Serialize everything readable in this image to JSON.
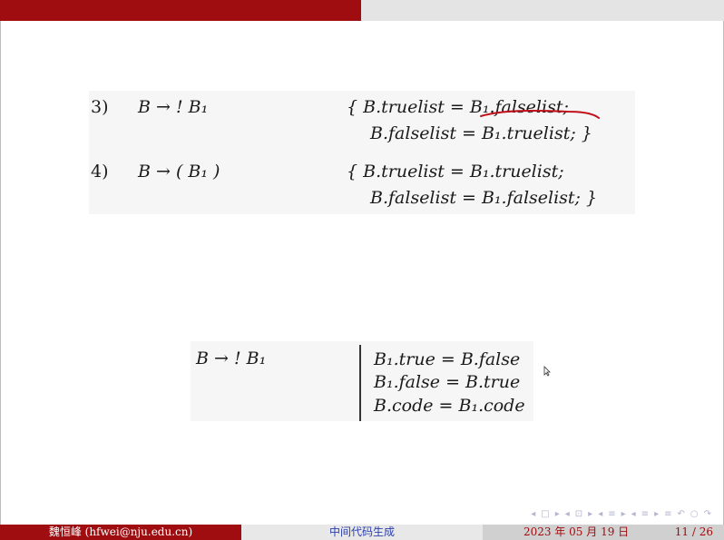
{
  "slide": {
    "rule3": {
      "label": "3)",
      "production": "B → ! B₁",
      "action_line1": "{  B.truelist = B₁.falselist;",
      "action_line2": "B.falselist = B₁.truelist;  }"
    },
    "rule4": {
      "label": "4)",
      "production": "B → ( B₁ )",
      "action_line1": "{  B.truelist = B₁.truelist;",
      "action_line2": "B.falselist  =  B₁.falselist;  }"
    },
    "lower": {
      "production": "B  →  ! B₁",
      "rule_line1": "B₁.true = B.false",
      "rule_line2": "B₁.false = B.true",
      "rule_line3": "B.code = B₁.code"
    },
    "annotation_color": "#c0101a"
  },
  "nav": {
    "icons": [
      "◂",
      "□",
      "▸",
      "◂",
      "⊡",
      "▸",
      "◂",
      "≡",
      "▸",
      "◂",
      "≡",
      "▸",
      "≡",
      "↶",
      "○",
      "↷"
    ]
  },
  "footer": {
    "author": "魏恒峰 (hfwei@nju.edu.cn)",
    "title": "中间代码生成",
    "date": "2023 年 05 月 19 日",
    "page": "11 / 26"
  }
}
